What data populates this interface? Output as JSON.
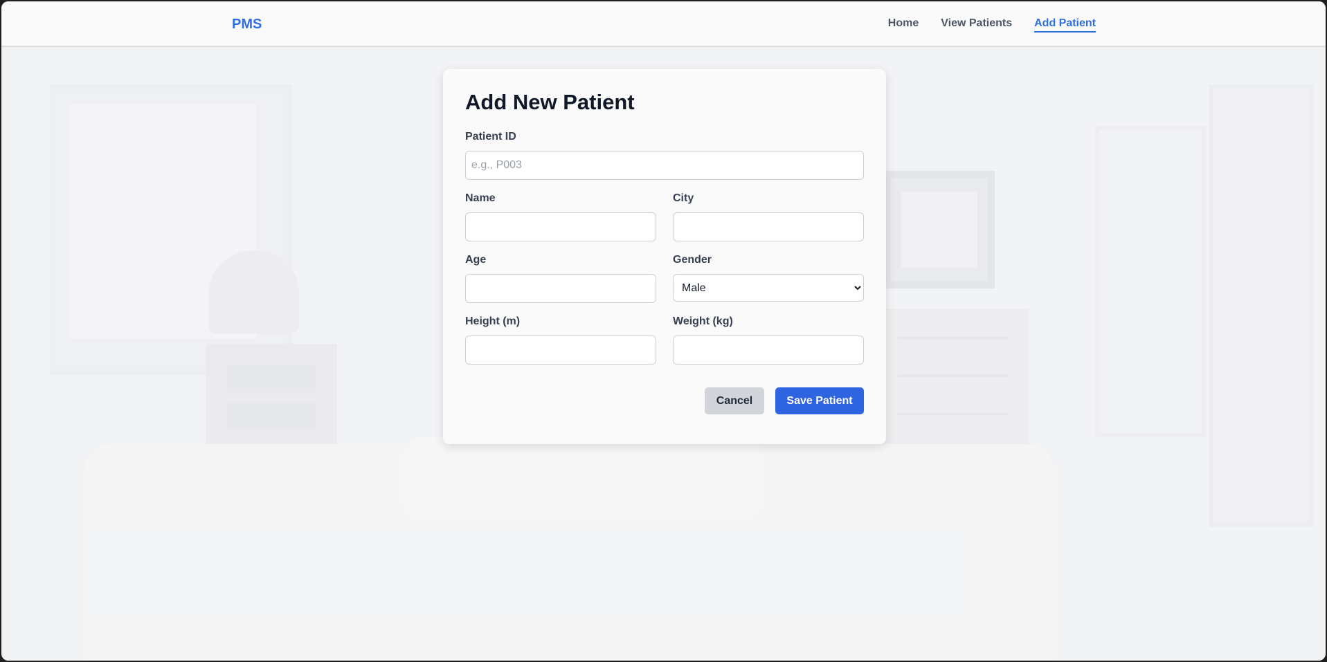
{
  "nav": {
    "brand": "PMS",
    "links": [
      {
        "label": "Home"
      },
      {
        "label": "View Patients"
      },
      {
        "label": "Add Patient",
        "active": true
      }
    ]
  },
  "form": {
    "title": "Add New Patient",
    "patient_id": {
      "label": "Patient ID",
      "placeholder": "e.g., P003",
      "value": ""
    },
    "name": {
      "label": "Name",
      "value": ""
    },
    "city": {
      "label": "City",
      "value": ""
    },
    "age": {
      "label": "Age",
      "value": ""
    },
    "gender": {
      "label": "Gender",
      "selected": "Male"
    },
    "height": {
      "label": "Height (m)",
      "value": ""
    },
    "weight": {
      "label": "Weight (kg)",
      "value": ""
    },
    "cancel_label": "Cancel",
    "save_label": "Save Patient"
  },
  "colors": {
    "accent": "#2f6fdf",
    "save_button": "#2f64e0",
    "cancel_button": "#d1d4d9"
  }
}
